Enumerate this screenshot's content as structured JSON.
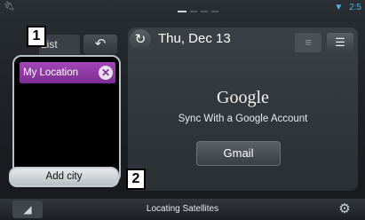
{
  "status_bar": {
    "time": "2:5"
  },
  "list_widget": {
    "tab_label": "List",
    "back_icon": "back-arrow-icon",
    "locations": [
      {
        "name": "My Location"
      }
    ],
    "add_city_label": "Add city"
  },
  "calendar_widget": {
    "date": "Thu, Dec 13",
    "google_logo": "Google",
    "sync_text": "Sync With a Google Account",
    "gmail_label": "Gmail"
  },
  "bottom_bar": {
    "status": "Locating Satellites"
  },
  "callouts": {
    "one": "1",
    "two": "2"
  },
  "colors": {
    "location_item": "#9a40b0",
    "time_accent": "#4db3e6"
  }
}
